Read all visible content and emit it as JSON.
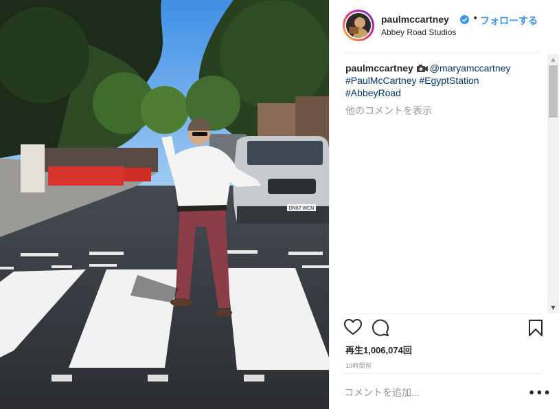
{
  "post": {
    "username": "paulmccartney",
    "separator": "•",
    "follow_label": "フォローする",
    "location": "Abbey Road Studios"
  },
  "caption": {
    "username": "paulmccartney",
    "mention": "@maryamccartney",
    "hashtags": [
      "#PaulMcCartney",
      "#EgyptStation",
      "#AbbeyRoad"
    ],
    "more_comments_label": "他のコメントを表示"
  },
  "stats": {
    "views_label": "再生1,006,074回",
    "time_ago": "19時間前"
  },
  "comment": {
    "placeholder": "コメントを追加..."
  },
  "media": {
    "van_plate": "DN67 WCN"
  },
  "colors": {
    "link_blue": "#3897f0",
    "hashtag_navy": "#003569",
    "muted_gray": "#999999"
  },
  "icons": [
    "verified-badge-icon",
    "heart-icon",
    "comment-icon",
    "bookmark-icon",
    "camera-icon",
    "more-options-icon"
  ]
}
